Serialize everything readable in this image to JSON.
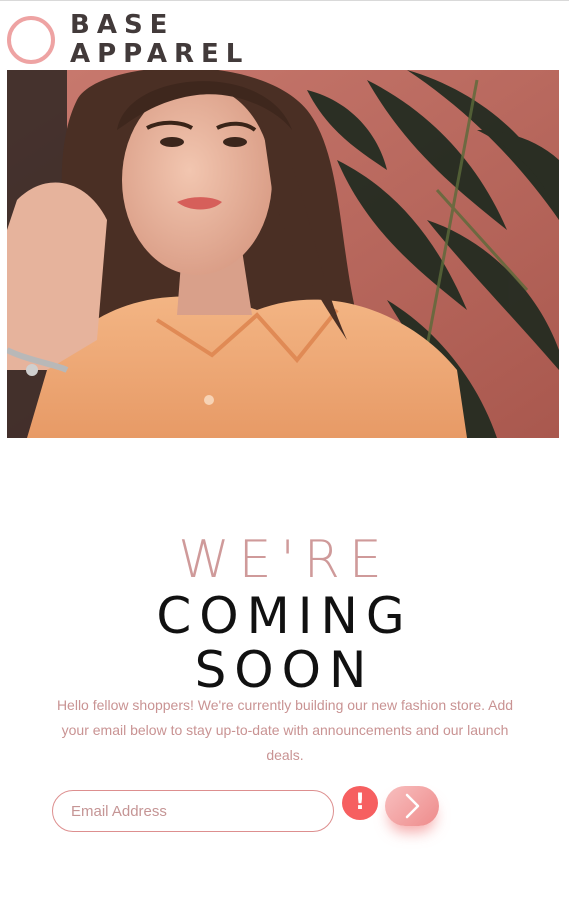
{
  "brand": {
    "line1": "BASE",
    "line2": "APPAREL",
    "accent_color": "#eea3a3",
    "text_color": "#423a3a"
  },
  "hero": {
    "alt": "Woman in orange shirt in front of plants"
  },
  "headline": {
    "line1": "WE'RE",
    "line2": "COMING",
    "line3": "SOON",
    "accent_color": "#cf9a9a"
  },
  "lead": {
    "text": "Hello fellow shoppers! We're currently building our new fashion store. Add your email below to stay up-to-date with announcements and our launch deals."
  },
  "form": {
    "email_placeholder": "Email Address",
    "email_value": "",
    "error_symbol": "!",
    "error_color": "#f65f60",
    "submit_icon": "chevron-right-icon"
  }
}
